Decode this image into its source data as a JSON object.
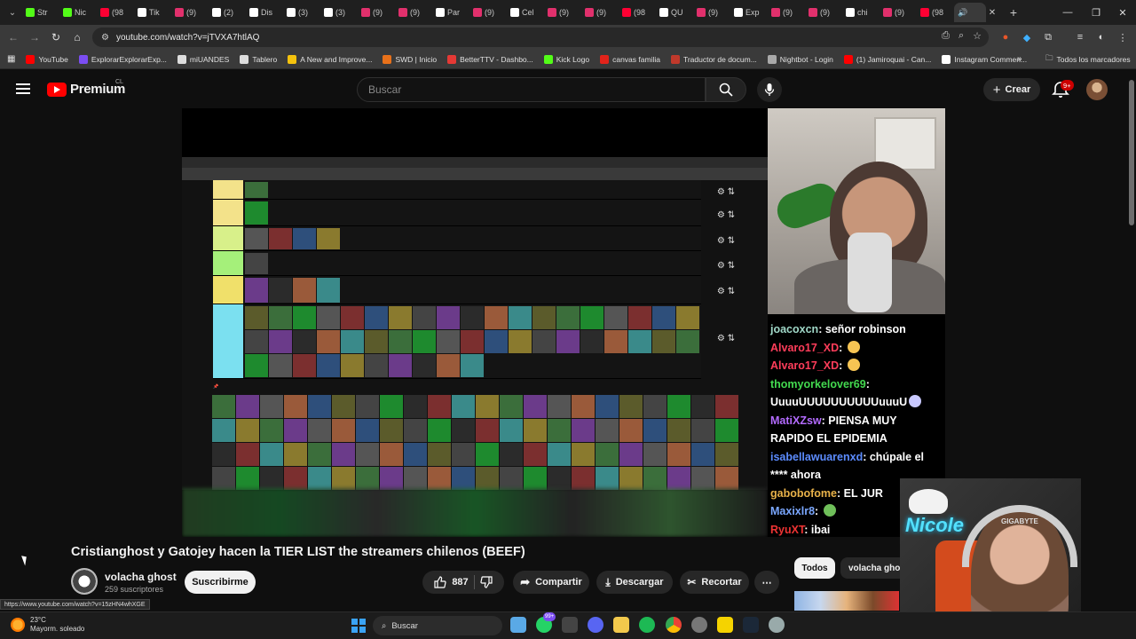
{
  "browser": {
    "tabs": [
      {
        "label": "Str",
        "color": "#53fc18"
      },
      {
        "label": "Nic",
        "color": "#53fc18"
      },
      {
        "label": "(98",
        "color": "#ff0033"
      },
      {
        "label": "Tik",
        "color": "#ffffff"
      },
      {
        "label": "(9)",
        "color": "#e1306c"
      },
      {
        "label": "(2)",
        "color": "#ffffff"
      },
      {
        "label": "Dis",
        "color": "#ffffff"
      },
      {
        "label": "(3)",
        "color": "#ffffff"
      },
      {
        "label": "(3)",
        "color": "#ffffff"
      },
      {
        "label": "(9)",
        "color": "#e1306c"
      },
      {
        "label": "(9)",
        "color": "#e1306c"
      },
      {
        "label": "Par",
        "color": "#ffffff"
      },
      {
        "label": "(9)",
        "color": "#e1306c"
      },
      {
        "label": "Cel",
        "color": "#ffffff"
      },
      {
        "label": "(9)",
        "color": "#e1306c"
      },
      {
        "label": "(9)",
        "color": "#e1306c"
      },
      {
        "label": "(98",
        "color": "#ff0033"
      },
      {
        "label": "QU",
        "color": "#ffffff"
      },
      {
        "label": "(9)",
        "color": "#e1306c"
      },
      {
        "label": "Exp",
        "color": "#ffffff"
      },
      {
        "label": "(9)",
        "color": "#e1306c"
      },
      {
        "label": "(9)",
        "color": "#e1306c"
      },
      {
        "label": "chi",
        "color": "#ffffff"
      },
      {
        "label": "(9)",
        "color": "#e1306c"
      },
      {
        "label": "(98",
        "color": "#ff0033"
      }
    ],
    "url": "youtube.com/watch?v=jTVXA7htlAQ",
    "bookmarks": [
      {
        "label": "YouTube",
        "color": "#ff0000"
      },
      {
        "label": "ExplorarExplorarExp...",
        "color": "#7b4df2"
      },
      {
        "label": "miUANDES",
        "color": "#dddddd"
      },
      {
        "label": "Tablero",
        "color": "#dddddd"
      },
      {
        "label": "A New and Improve...",
        "color": "#f4c20d"
      },
      {
        "label": "SWD | Inicio",
        "color": "#e8711a"
      },
      {
        "label": "BetterTTV - Dashbo...",
        "color": "#e53935"
      },
      {
        "label": "Kick Logo",
        "color": "#53fc18"
      },
      {
        "label": "canvas familia",
        "color": "#e2231a"
      },
      {
        "label": "Traductor de docum...",
        "color": "#c0392b"
      },
      {
        "label": "Nightbot - Login",
        "color": "#aaaaaa"
      },
      {
        "label": "(1) Jamiroquai - Can...",
        "color": "#ff0000"
      },
      {
        "label": "Instagram Commen...",
        "color": "#ffffff"
      }
    ],
    "all_bookmarks": "Todos los marcadores",
    "status_url": "https://www.youtube.com/watch?v=15zHN4whXGE"
  },
  "youtube": {
    "logo_text": "Premium",
    "country": "CL",
    "search_placeholder": "Buscar",
    "create_label": "Crear",
    "notifications": "9+",
    "video_title": "Cristianghost y Gatojey hacen la TIER LIST the streamers chilenos (BEEF)",
    "channel_name": "volacha ghost",
    "subscribers": "259 suscriptores",
    "subscribe_label": "Suscribirme",
    "likes": "887",
    "share_label": "Compartir",
    "download_label": "Descargar",
    "clip_label": "Recortar",
    "more_label": "⋯",
    "chips": [
      "Todos",
      "volacha ghost"
    ]
  },
  "stream_chat": [
    {
      "user": "joacoxcn",
      "color": "#a0d8c8",
      "text": "señor robinson"
    },
    {
      "user": "Alvaro17_XD",
      "color": "#ff3d5a",
      "text": "",
      "emote": "#f6c453"
    },
    {
      "user": "Alvaro17_XD",
      "color": "#ff3d5a",
      "text": "",
      "emote": "#f6c453"
    },
    {
      "user": "thomyorkelover69",
      "color": "#43d94f",
      "text": "UuuuUUUUUUUUUUuuuU",
      "emote": "#c9c9ff"
    },
    {
      "user": "MatiXZsw",
      "color": "#b36bff",
      "text": "PIENSA MUY RAPIDO EL EPIDEMIA"
    },
    {
      "user": "isabellawuarenxd",
      "color": "#5c8cff",
      "text": "chúpale el **** ahora"
    },
    {
      "user": "gabobofome",
      "color": "#e8b24a",
      "text": "EL JUR"
    },
    {
      "user": "Maxixlr8",
      "color": "#7aa7ff",
      "text": "",
      "emote": "#6fbf5a"
    },
    {
      "user": "RyuXT",
      "color": "#e33",
      "text": "ibai"
    }
  ],
  "overlay": {
    "neon_text": "Nicole",
    "brand": "GIGABYTE"
  },
  "taskbar": {
    "temperature": "23°C",
    "weather": "Mayorm. soleado",
    "search": "Buscar",
    "badge": "99+"
  }
}
